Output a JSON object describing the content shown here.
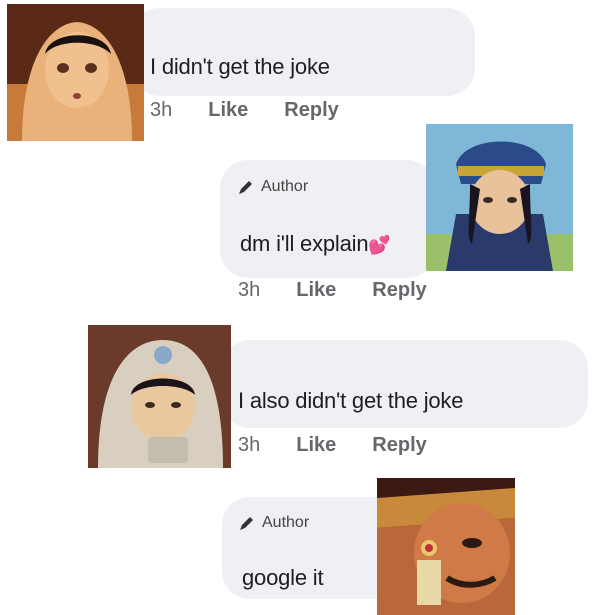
{
  "comments": [
    {
      "text": "I didn't get the joke",
      "time": "3h",
      "like_label": "Like",
      "reply_label": "Reply",
      "avatar_icon": "avatar-girl-headscarf-icon"
    },
    {
      "author_badge": "Author",
      "text": "dm i'll explain",
      "emoji": "💕",
      "time": "3h",
      "like_label": "Like",
      "reply_label": "Reply",
      "avatar_icon": "avatar-blue-hat-icon"
    },
    {
      "text": "I also didn't get the joke",
      "time": "3h",
      "like_label": "Like",
      "reply_label": "Reply",
      "avatar_icon": "avatar-boy-cup-icon"
    },
    {
      "author_badge": "Author",
      "text": "google it",
      "avatar_icon": "avatar-closeup-face-icon"
    }
  ],
  "colors": {
    "bubble": "#eff0f3",
    "meta_text": "#65676b",
    "heart": "#e8358c"
  }
}
